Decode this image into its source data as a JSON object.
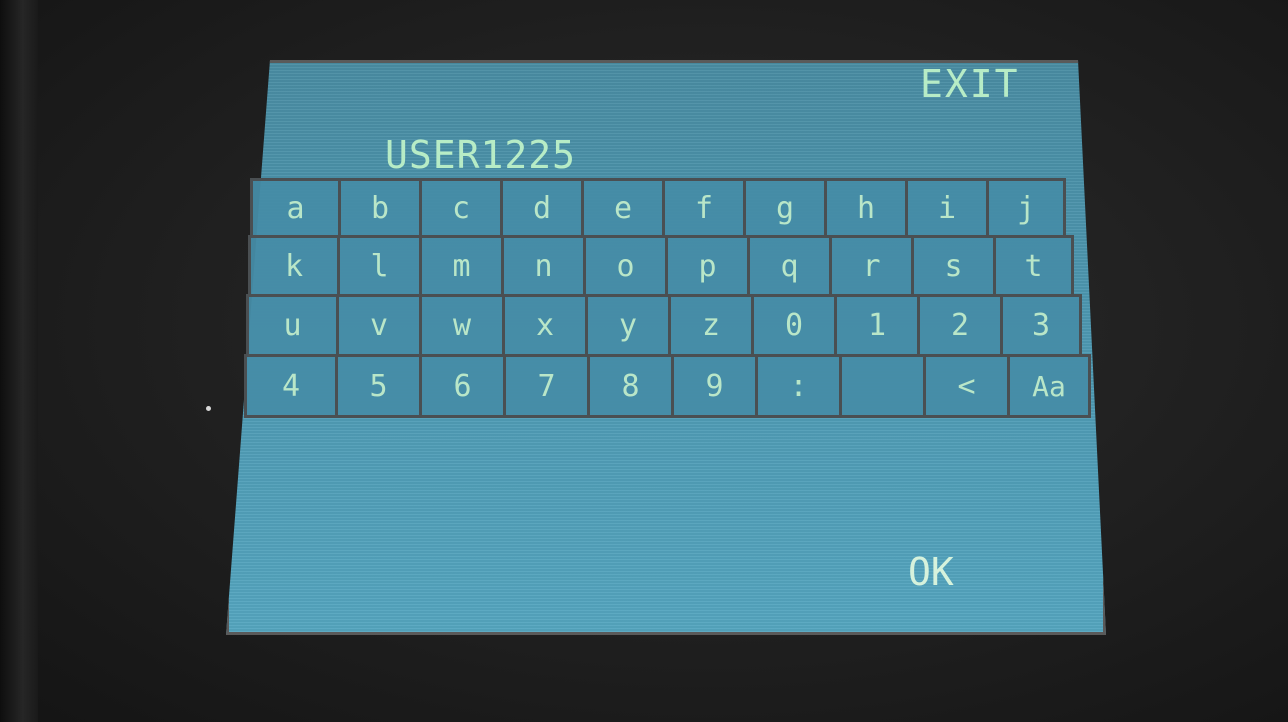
{
  "screen": {
    "exit_label": "EXIT",
    "name_value": "USER1225",
    "ok_label": "OK"
  },
  "keyboard": {
    "rows": [
      [
        "a",
        "b",
        "c",
        "d",
        "e",
        "f",
        "g",
        "h",
        "i",
        "j"
      ],
      [
        "k",
        "l",
        "m",
        "n",
        "o",
        "p",
        "q",
        "r",
        "s",
        "t"
      ],
      [
        "u",
        "v",
        "w",
        "x",
        "y",
        "z",
        "0",
        "1",
        "2",
        "3"
      ],
      [
        "4",
        "5",
        "6",
        "7",
        "8",
        "9",
        ":",
        "",
        "<",
        "Aa"
      ]
    ]
  },
  "colors": {
    "lcd_background": "#4d97b0",
    "lcd_text": "#b7ecc6",
    "key_border": "#4a4f52"
  }
}
